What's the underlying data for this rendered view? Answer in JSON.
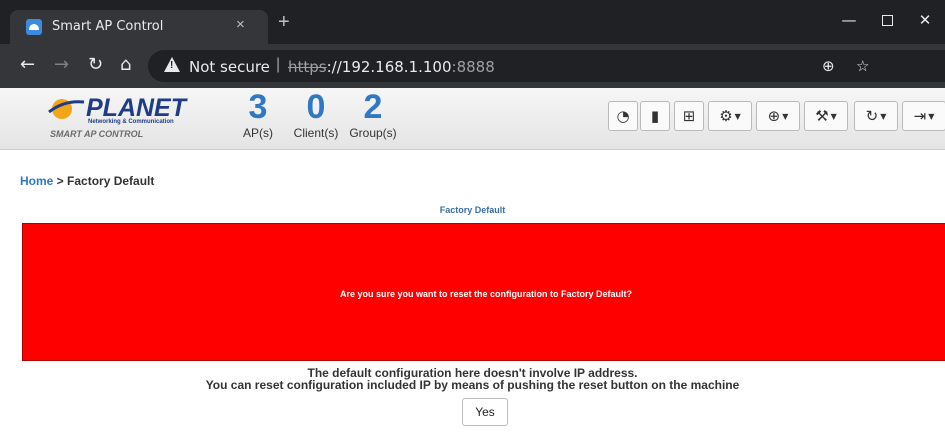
{
  "browser": {
    "tab_title": "Smart AP Control",
    "tab_close": "×",
    "new_tab": "+",
    "not_secure": "Not secure",
    "url_scheme": "https",
    "url_host": "://192.168.1.100",
    "url_port": ":8888"
  },
  "header": {
    "logo_name": "PLANET",
    "logo_sub": "Networking & Communication",
    "logo_caption": "SMART AP CONTROL",
    "stats": [
      {
        "value": "3",
        "label": "AP(s)"
      },
      {
        "value": "0",
        "label": "Client(s)"
      },
      {
        "value": "2",
        "label": "Group(s)"
      }
    ],
    "toolbar_icons": [
      "dashboard-icon",
      "statistics-icon",
      "topology-icon",
      "gear-icon",
      "globe-icon",
      "wrench-icon",
      "refresh-icon",
      "logout-icon"
    ]
  },
  "breadcrumb": {
    "home": "Home",
    "separator": " > ",
    "current": "Factory Default"
  },
  "section_title": "Factory Default",
  "alert": {
    "message": "Are you sure you want to reset the configuration to Factory Default?",
    "color": "#ff0000"
  },
  "note": {
    "line1": "The default configuration here doesn't involve IP address.",
    "line2": "You can reset configuration included IP by means of pushing the reset button on the machine"
  },
  "confirm_button": "Yes",
  "colors": {
    "accent": "#2f78c4",
    "alert": "#ff0000"
  }
}
